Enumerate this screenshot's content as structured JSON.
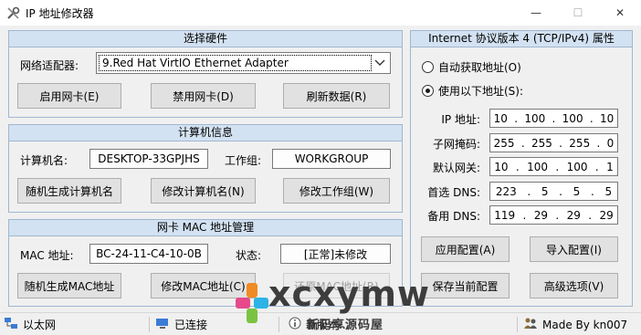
{
  "window": {
    "title": "IP 地址修改器",
    "min": "—",
    "max": "☐",
    "close": "✕"
  },
  "hardware": {
    "header": "选择硬件",
    "adapter_label": "网络适配器:",
    "adapter_value": "9.Red Hat VirtIO Ethernet Adapter",
    "enable_btn": "启用网卡(E)",
    "disable_btn": "禁用网卡(D)",
    "refresh_btn": "刷新数据(R)"
  },
  "computer": {
    "header": "计算机信息",
    "name_label": "计算机名:",
    "name_value": "DESKTOP-33GPJHS",
    "workgroup_label": "工作组:",
    "workgroup_value": "WORKGROUP",
    "random_name_btn": "随机生成计算机名",
    "modify_name_btn": "修改计算机名(N)",
    "modify_workgroup_btn": "修改工作组(W)"
  },
  "mac": {
    "header": "网卡 MAC 地址管理",
    "mac_label": "MAC 地址:",
    "mac_value": "BC-24-11-C4-10-0B",
    "status_label": "状态:",
    "status_value": "[正常]未修改",
    "random_mac_btn": "随机生成MAC地址",
    "modify_mac_btn": "修改MAC地址(C)",
    "restore_mac_btn": "还原MAC地址(R)"
  },
  "ipv4": {
    "header": "Internet 协议版本 4 (TCP/IPv4) 属性",
    "auto_radio": "自动获取地址(O)",
    "manual_radio": "使用以下地址(S):",
    "ip_label": "IP 地址:",
    "ip": [
      "10",
      "100",
      "100",
      "10"
    ],
    "mask_label": "子网掩码:",
    "mask": [
      "255",
      "255",
      "255",
      "0"
    ],
    "gateway_label": "默认网关:",
    "gateway": [
      "10",
      "100",
      "100",
      "1"
    ],
    "dns1_label": "首选 DNS:",
    "dns1": [
      "223",
      "5",
      "5",
      "5"
    ],
    "dns2_label": "备用 DNS:",
    "dns2": [
      "119",
      "29",
      "29",
      "29"
    ],
    "apply_btn": "应用配置(A)",
    "import_btn": "导入配置(I)",
    "save_btn": "保存当前配置",
    "advanced_btn": "高级选项(V)"
  },
  "statusbar": {
    "network": "以太网",
    "connection": "已连接",
    "info": "新版本...",
    "author": "Made By kn007"
  },
  "watermark": {
    "text": "xcxymw",
    "sub": "新码享源码屋"
  }
}
